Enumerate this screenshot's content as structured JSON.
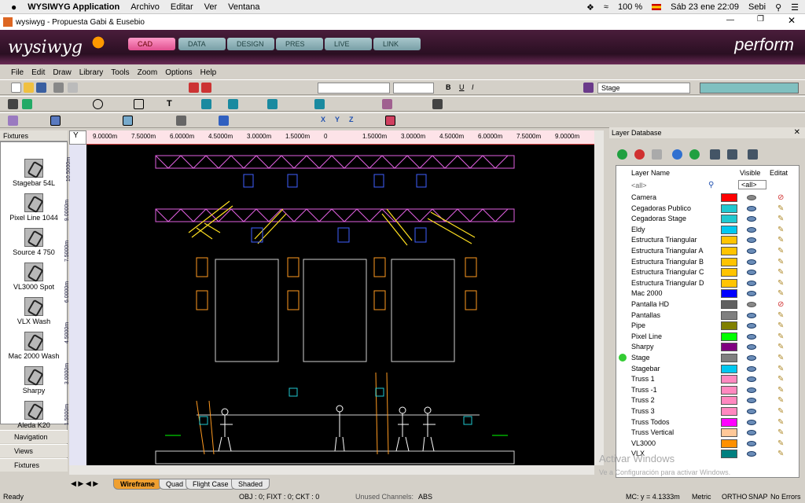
{
  "mac_menubar": {
    "apple": "",
    "app_name": "WYSIWYG Application",
    "menus": [
      "Archivo",
      "Editar",
      "Ver",
      "Ventana"
    ],
    "battery": "100 %",
    "date_time": "Sáb 23 ene  22:09",
    "user": "Sebi"
  },
  "window": {
    "title": "wysiwyg - Propuesta Gabi & Eusebio"
  },
  "brand": {
    "logo": "wysiwyg",
    "mode": "perform",
    "tabs": [
      "CAD",
      "DATA",
      "DESIGN",
      "PRES",
      "LIVE",
      "LINK"
    ]
  },
  "menubar": [
    "File",
    "Edit",
    "Draw",
    "Library",
    "Tools",
    "Zoom",
    "Options",
    "Help"
  ],
  "toolbar": {
    "layer_select": "Stage"
  },
  "fixtures_panel": {
    "title": "Fixtures",
    "items": [
      "Stagebar 54L",
      "Pixel Line 1044",
      "Source 4 750",
      "VL3000 Spot",
      "VLX Wash",
      "Mac 2000 Wash",
      "Sharpy",
      "Aleda K20"
    ],
    "nav": [
      "Navigation",
      "Views",
      "Fixtures"
    ]
  },
  "ruler": {
    "h_labels": [
      "9.0000m",
      "7.5000m",
      "6.0000m",
      "4.5000m",
      "3.0000m",
      "1.5000m",
      "0",
      "1.5000m",
      "3.0000m",
      "4.5000m",
      "6.0000m",
      "7.5000m",
      "9.0000m"
    ],
    "v_labels": [
      "10.5000m",
      "9.0000m",
      "7.5000m",
      "6.0000m",
      "4.5000m",
      "3.0000m",
      "1.5000m"
    ]
  },
  "layer_db": {
    "title": "Layer Database",
    "col_name": "Layer Name",
    "col_visible": "Visible",
    "col_editable": "Editat",
    "filter_name": "<all>",
    "filter_visible": "<all>",
    "layers": [
      {
        "name": "Camera",
        "color": "#ff0000",
        "visible": false,
        "editable": false,
        "current": false
      },
      {
        "name": "Cegadoras Publico",
        "color": "#20c8d0",
        "visible": true,
        "editable": true,
        "current": false
      },
      {
        "name": "Cegadoras Stage",
        "color": "#20c8d0",
        "visible": true,
        "editable": true,
        "current": false
      },
      {
        "name": "Eldy",
        "color": "#00c8f0",
        "visible": true,
        "editable": true,
        "current": false
      },
      {
        "name": "Estructura Triangular",
        "color": "#ffc400",
        "visible": true,
        "editable": true,
        "current": false
      },
      {
        "name": "Estructura Triangular A",
        "color": "#ffc400",
        "visible": true,
        "editable": true,
        "current": false
      },
      {
        "name": "Estructura Triangular B",
        "color": "#ffc400",
        "visible": true,
        "editable": true,
        "current": false
      },
      {
        "name": "Estructura Triangular C",
        "color": "#ffc400",
        "visible": true,
        "editable": true,
        "current": false
      },
      {
        "name": "Estructura Triangular D",
        "color": "#ffc400",
        "visible": true,
        "editable": true,
        "current": false
      },
      {
        "name": "Mac 2000",
        "color": "#0000ff",
        "visible": true,
        "editable": true,
        "current": false
      },
      {
        "name": "Pantalla HD",
        "color": "#606060",
        "visible": false,
        "editable": false,
        "current": false
      },
      {
        "name": "Pantallas",
        "color": "#808080",
        "visible": true,
        "editable": true,
        "current": false
      },
      {
        "name": "Pipe",
        "color": "#808000",
        "visible": true,
        "editable": true,
        "current": false
      },
      {
        "name": "Pixel Line",
        "color": "#00ff00",
        "visible": true,
        "editable": true,
        "current": false
      },
      {
        "name": "Sharpy",
        "color": "#800080",
        "visible": true,
        "editable": true,
        "current": false
      },
      {
        "name": "Stage",
        "color": "#808080",
        "visible": true,
        "editable": true,
        "current": true
      },
      {
        "name": "Stagebar",
        "color": "#00c8f0",
        "visible": true,
        "editable": true,
        "current": false
      },
      {
        "name": "Truss 1",
        "color": "#ff88c0",
        "visible": true,
        "editable": true,
        "current": false
      },
      {
        "name": "Truss -1",
        "color": "#ff88c0",
        "visible": true,
        "editable": true,
        "current": false
      },
      {
        "name": "Truss 2",
        "color": "#ff88c0",
        "visible": true,
        "editable": true,
        "current": false
      },
      {
        "name": "Truss 3",
        "color": "#ff88c0",
        "visible": true,
        "editable": true,
        "current": false
      },
      {
        "name": "Truss Todos",
        "color": "#ff00ff",
        "visible": true,
        "editable": true,
        "current": false
      },
      {
        "name": "Truss Vertical",
        "color": "#ffc898",
        "visible": true,
        "editable": true,
        "current": false
      },
      {
        "name": "VL3000",
        "color": "#ff9000",
        "visible": true,
        "editable": true,
        "current": false
      },
      {
        "name": "VLX",
        "color": "#008080",
        "visible": true,
        "editable": true,
        "current": false
      }
    ]
  },
  "view_tabs": [
    "Wireframe",
    "Quad",
    "Flight Case",
    "Shaded"
  ],
  "activation": {
    "line1": "Activar Windows",
    "line2": "Ve a Configuración para activar Windows."
  },
  "status": {
    "ready": "Ready",
    "counts": "OBJ : 0; FIXT : 0; CKT : 0",
    "unused": "Unused Channels:",
    "abs": "ABS",
    "coord": "MC: y = 4.1333m",
    "metric": "Metric",
    "ortho": "ORTHO",
    "snap": "SNAP",
    "errors": "No Errors"
  }
}
